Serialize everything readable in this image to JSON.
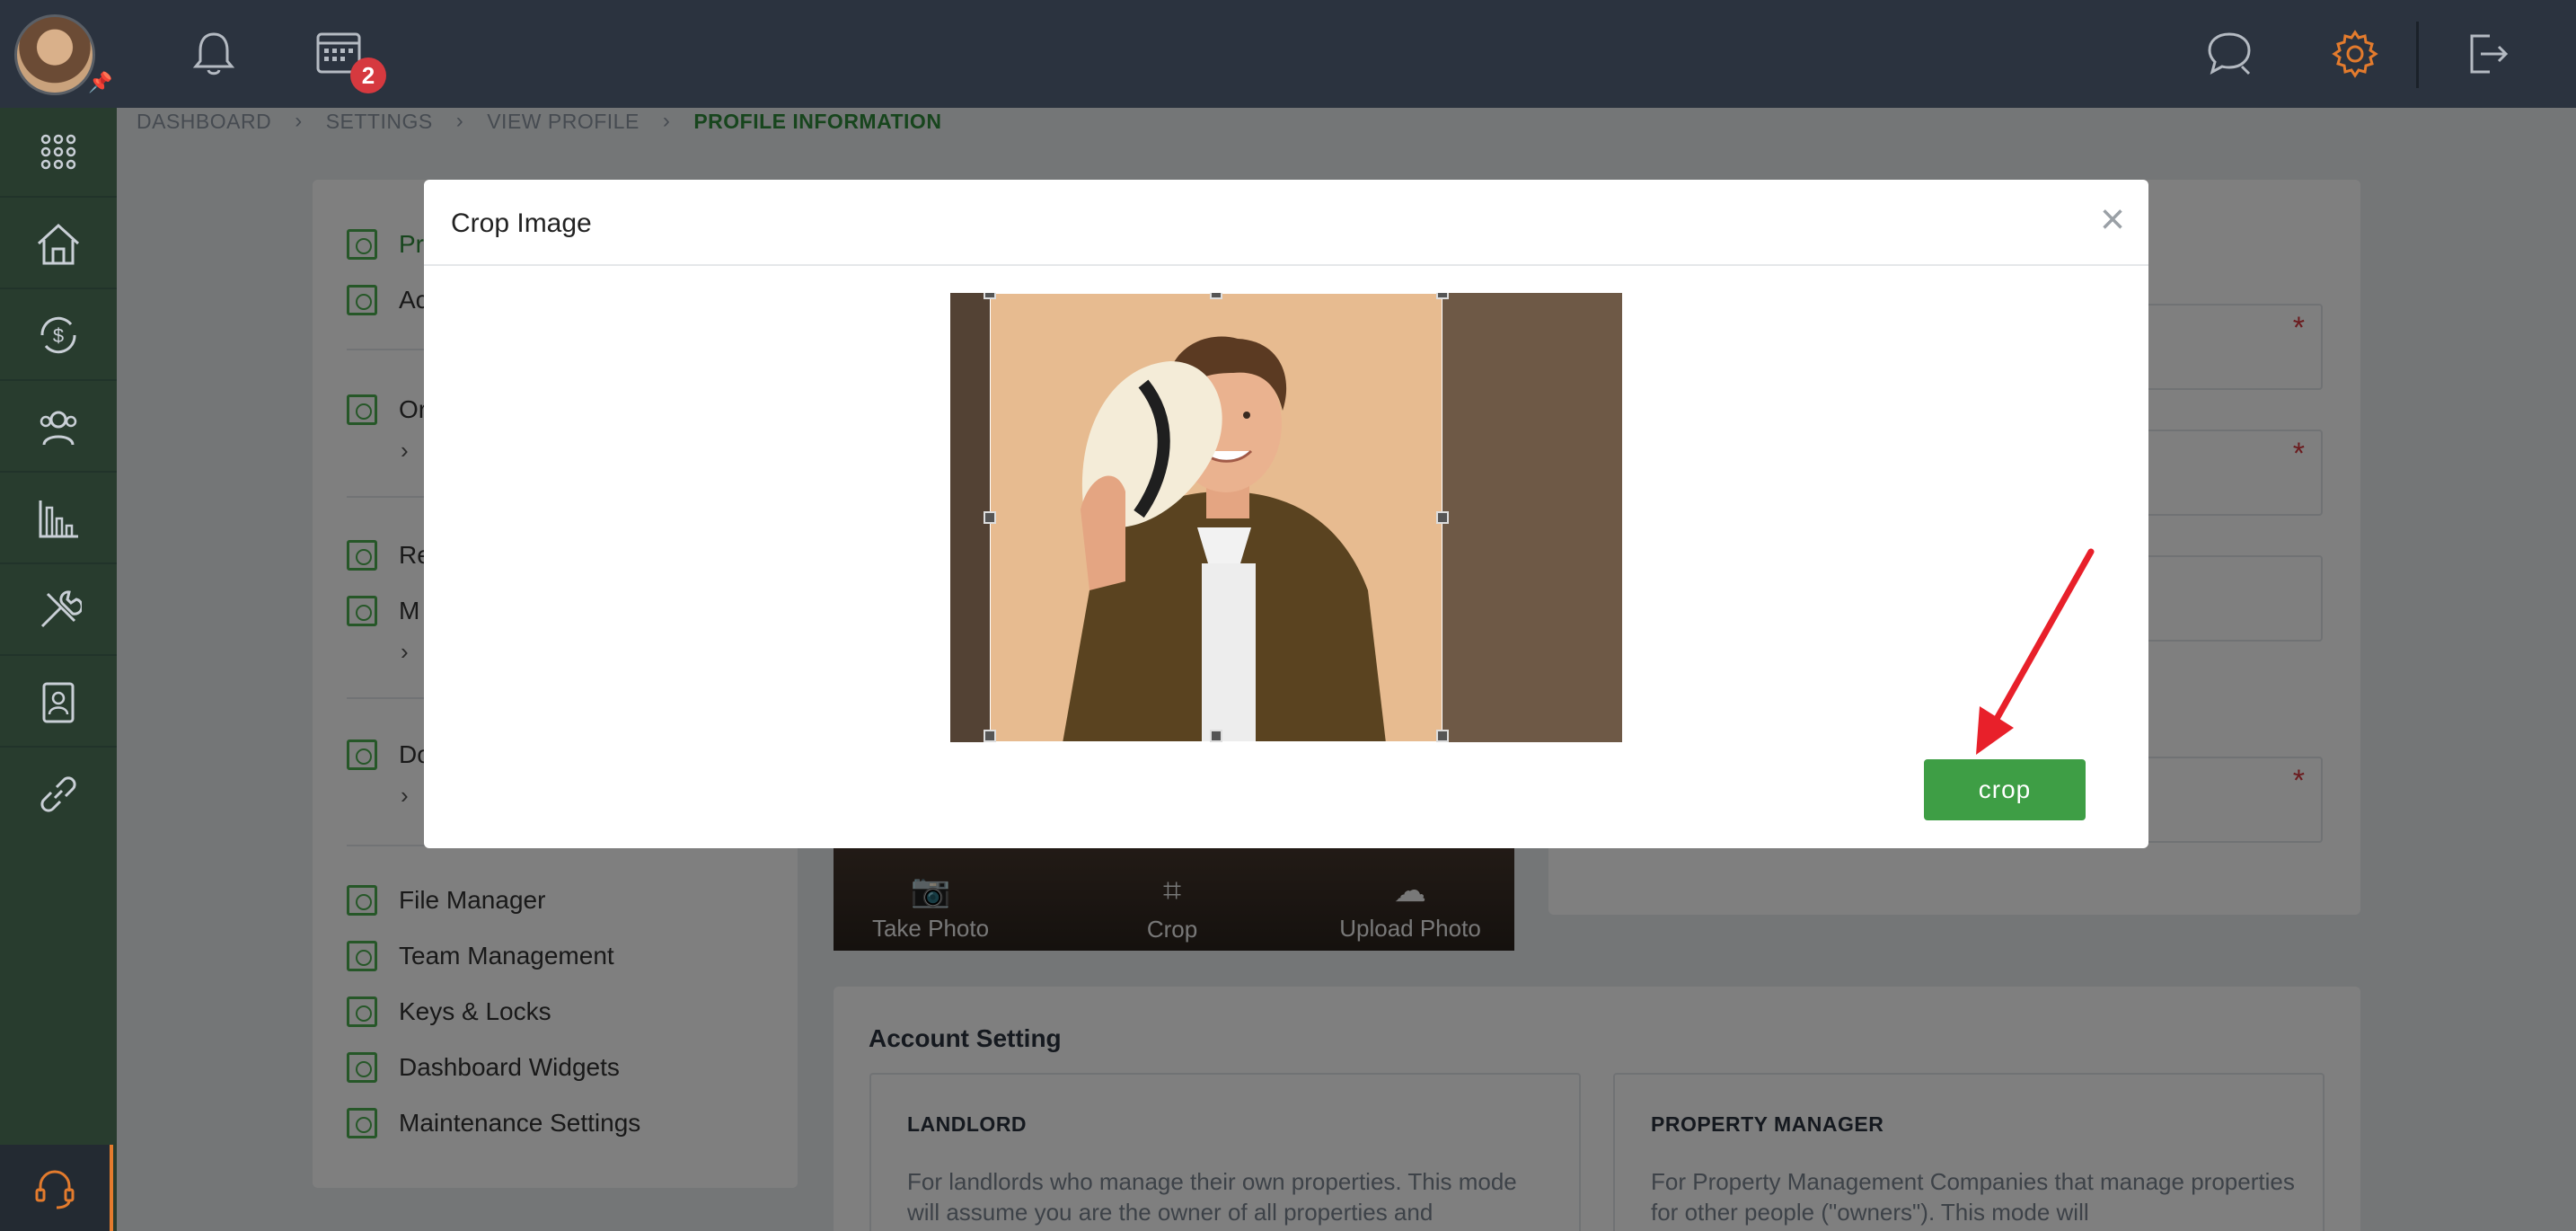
{
  "breadcrumb": {
    "items": [
      "DASHBOARD",
      "SETTINGS",
      "VIEW PROFILE",
      "PROFILE INFORMATION"
    ]
  },
  "topbar": {
    "calendar_badge": "2"
  },
  "settings_menu": {
    "items": [
      {
        "label": "Pr"
      },
      {
        "label": "Ac"
      },
      {
        "label": "Or"
      },
      {
        "label": "Re"
      },
      {
        "label": "M"
      },
      {
        "label": "Do"
      },
      {
        "label": "File Manager"
      },
      {
        "label": "Team Management"
      },
      {
        "label": "Keys & Locks"
      },
      {
        "label": "Dashboard Widgets"
      },
      {
        "label": "Maintenance Settings"
      }
    ]
  },
  "photo_actions": {
    "take_photo": "Take Photo",
    "crop": "Crop",
    "upload_photo": "Upload Photo"
  },
  "account_setting": {
    "title": "Account Setting",
    "landlord": {
      "title": "LANDLORD",
      "desc": "For landlords who manage their own properties. This mode will assume you are the owner of all properties and"
    },
    "property_manager": {
      "title": "PROPERTY MANAGER",
      "desc": "For Property Management Companies that manage properties for other people (\"owners\"). This mode will"
    }
  },
  "modal": {
    "title": "Crop Image",
    "close": "×",
    "crop_button": "crop"
  },
  "colors": {
    "topbar": "#2b333f",
    "sidebar": "#283c2e",
    "accent_green": "#3e9e45",
    "badge_red": "#d6393f",
    "gear_orange": "#e37b2d",
    "arrow_red": "#e8202a"
  },
  "icons": {
    "sidebar": [
      "apps-grid-icon",
      "house-icon",
      "money-cycle-icon",
      "people-icon",
      "chart-icon",
      "tools-icon",
      "contact-card-icon",
      "link-icon",
      "headset-icon"
    ],
    "topbar": [
      "bell-icon",
      "calendar-icon",
      "chat-icon",
      "gear-icon",
      "logout-icon"
    ]
  }
}
